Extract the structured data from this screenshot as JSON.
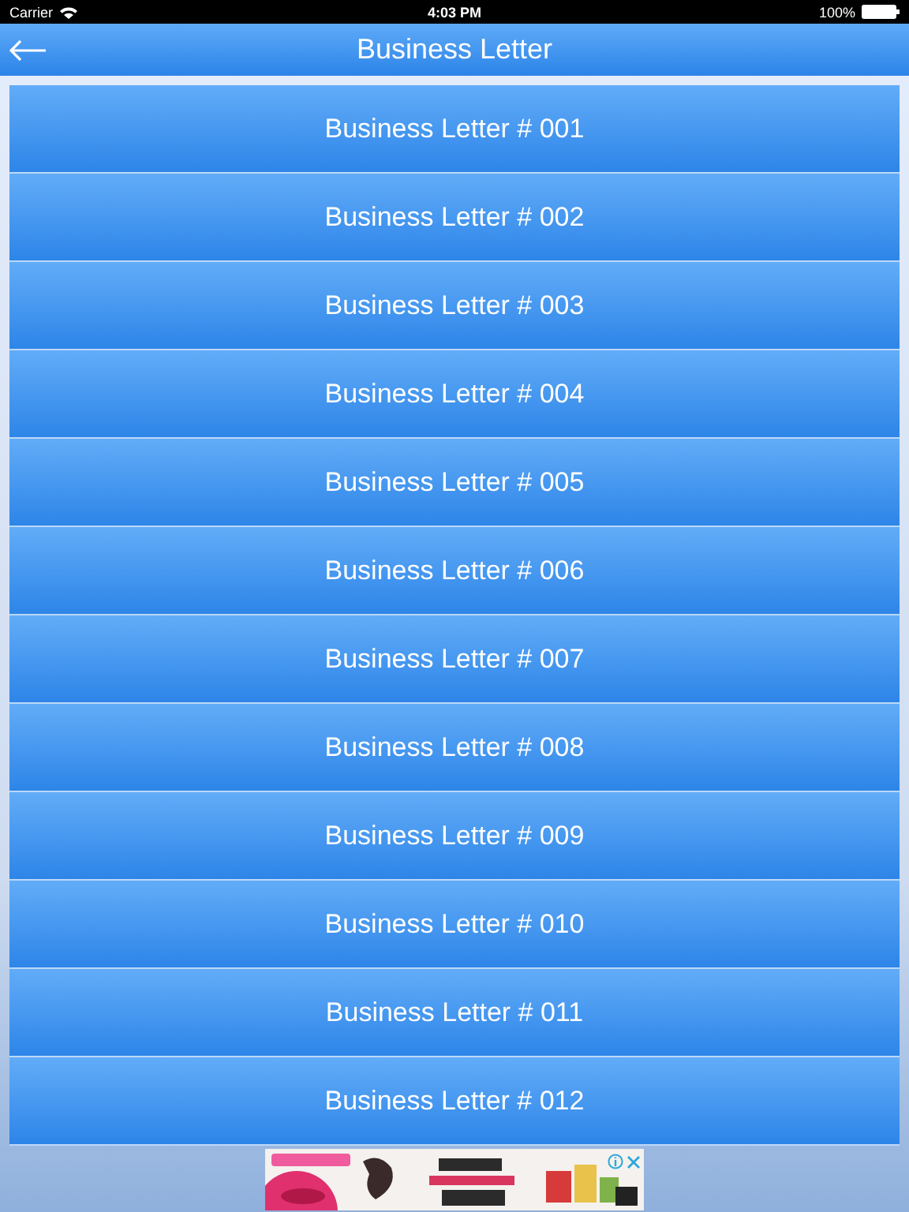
{
  "status_bar": {
    "carrier": "Carrier",
    "time": "4:03 PM",
    "battery": "100%"
  },
  "nav_bar": {
    "title": "Business Letter"
  },
  "letters": [
    {
      "label": "Business Letter # 001"
    },
    {
      "label": "Business Letter # 002"
    },
    {
      "label": "Business Letter # 003"
    },
    {
      "label": "Business Letter # 004"
    },
    {
      "label": "Business Letter # 005"
    },
    {
      "label": "Business Letter # 006"
    },
    {
      "label": "Business Letter # 007"
    },
    {
      "label": "Business Letter # 008"
    },
    {
      "label": "Business Letter # 009"
    },
    {
      "label": "Business Letter # 010"
    },
    {
      "label": "Business Letter # 011"
    },
    {
      "label": "Business Letter # 012"
    }
  ]
}
